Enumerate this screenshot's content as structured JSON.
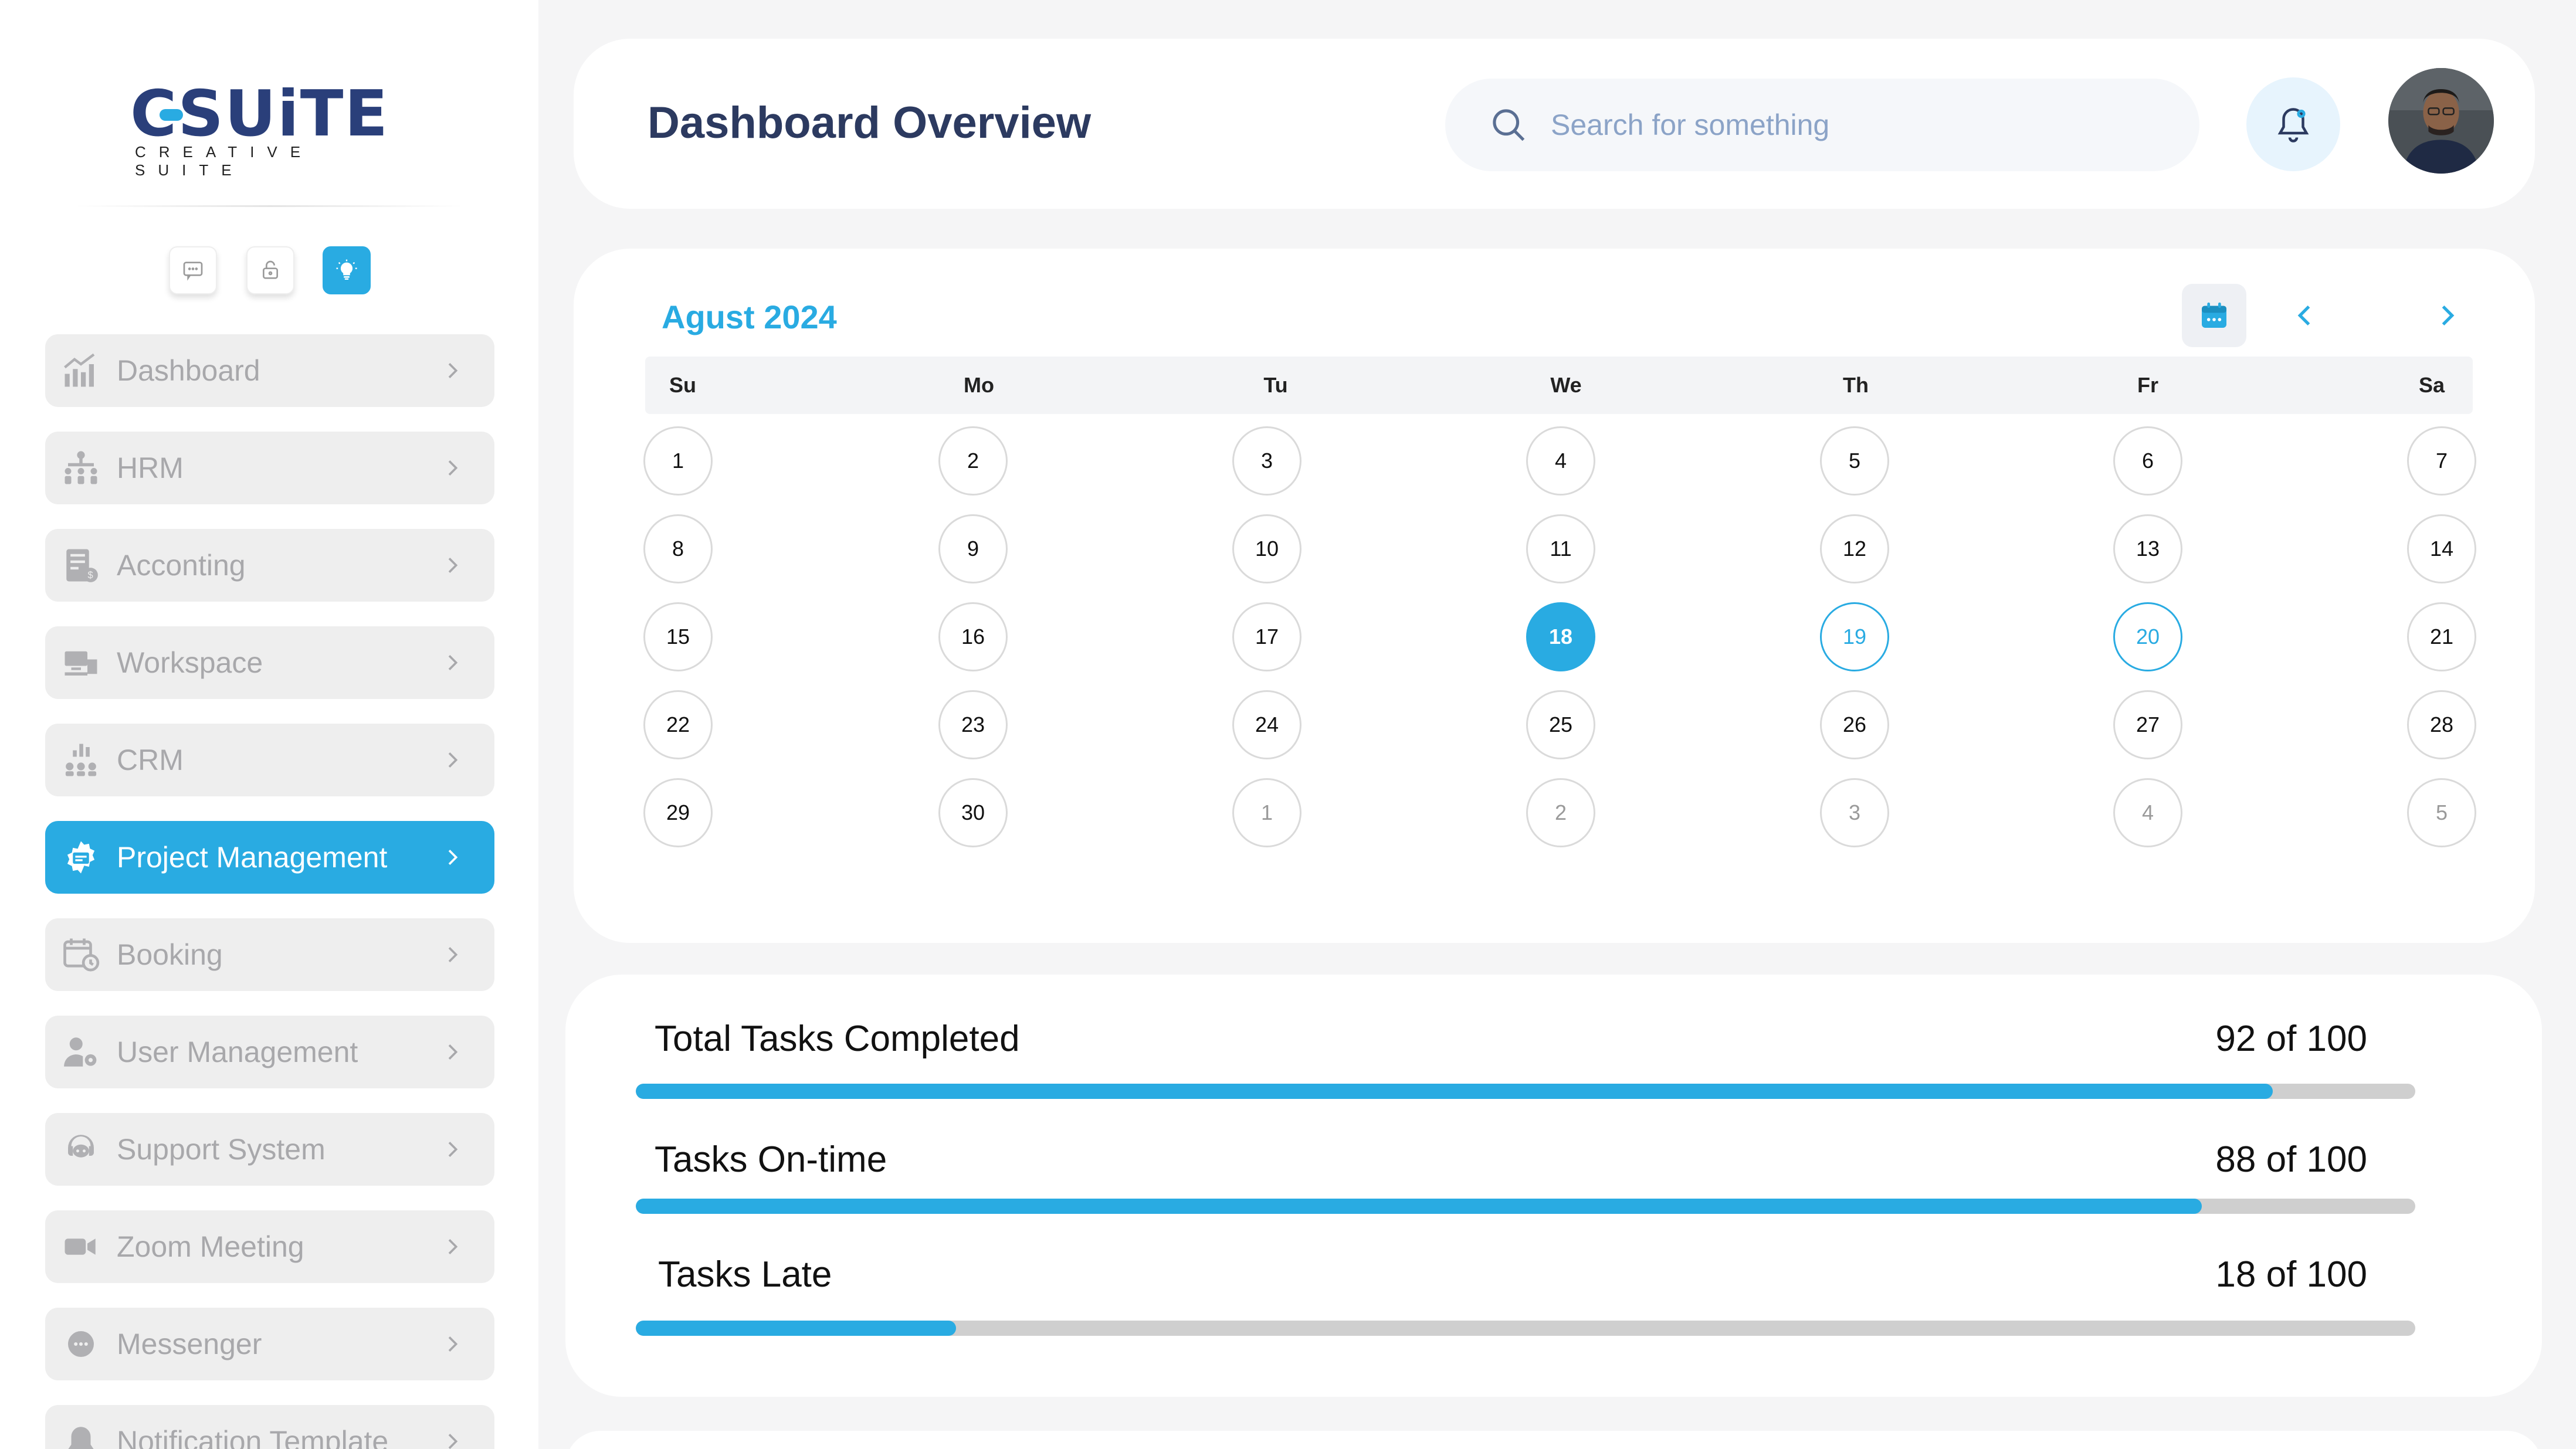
{
  "brand": {
    "name": "SUiTE",
    "letter": "C",
    "tagline": "CREATIVE SUITE",
    "accent": "#29abe2",
    "navy": "#2a3f7a"
  },
  "sidebar": {
    "quick_buttons": [
      {
        "icon": "chat-icon"
      },
      {
        "icon": "lock-icon"
      },
      {
        "icon": "lightbulb-icon",
        "active": true
      }
    ],
    "items": [
      {
        "label": "Dashboard",
        "icon": "chart-icon"
      },
      {
        "label": "HRM",
        "icon": "org-chart-icon"
      },
      {
        "label": "Acconting",
        "icon": "ledger-icon"
      },
      {
        "label": "Workspace",
        "icon": "workspace-icon"
      },
      {
        "label": "CRM",
        "icon": "crm-icon"
      },
      {
        "label": "Project Management",
        "icon": "project-icon",
        "active": true
      },
      {
        "label": "Booking",
        "icon": "calendar-clock-icon"
      },
      {
        "label": "User Management",
        "icon": "user-gear-icon"
      },
      {
        "label": "Support System",
        "icon": "support-icon"
      },
      {
        "label": "Zoom Meeting",
        "icon": "video-icon"
      },
      {
        "label": "Messenger",
        "icon": "message-icon"
      },
      {
        "label": "Notification Template",
        "icon": "bell-icon"
      }
    ]
  },
  "header": {
    "title": "Dashboard Overview",
    "search_placeholder": "Search for something",
    "notifications_icon": "bell-icon",
    "avatar_icon": "user-avatar"
  },
  "calendar": {
    "month_label": "Agust 2024",
    "weekdays": [
      "Su",
      "Mo",
      "Tu",
      "We",
      "Th",
      "Fr",
      "Sa"
    ],
    "weeks": [
      [
        "1",
        "2",
        "3",
        "4",
        "5",
        "6",
        "7"
      ],
      [
        "8",
        "9",
        "10",
        "11",
        "12",
        "13",
        "14"
      ],
      [
        "15",
        "16",
        "17",
        "18",
        "19",
        "20",
        "21"
      ],
      [
        "22",
        "23",
        "24",
        "25",
        "26",
        "27",
        "28"
      ],
      [
        "29",
        "30",
        "1",
        "2",
        "3",
        "4",
        "5"
      ]
    ],
    "selected_day": "18",
    "highlighted_days": [
      "19",
      "20"
    ],
    "trailing_days_from_next_month": 5
  },
  "stats": [
    {
      "label": "Total Tasks Completed",
      "value_text": "92 of 100",
      "value": 92,
      "total": 100
    },
    {
      "label": "Tasks On-time",
      "value_text": "88 of 100",
      "value": 88,
      "total": 100
    },
    {
      "label": "Tasks Late",
      "value_text": "18 of 100",
      "value": 18,
      "total": 100
    }
  ]
}
